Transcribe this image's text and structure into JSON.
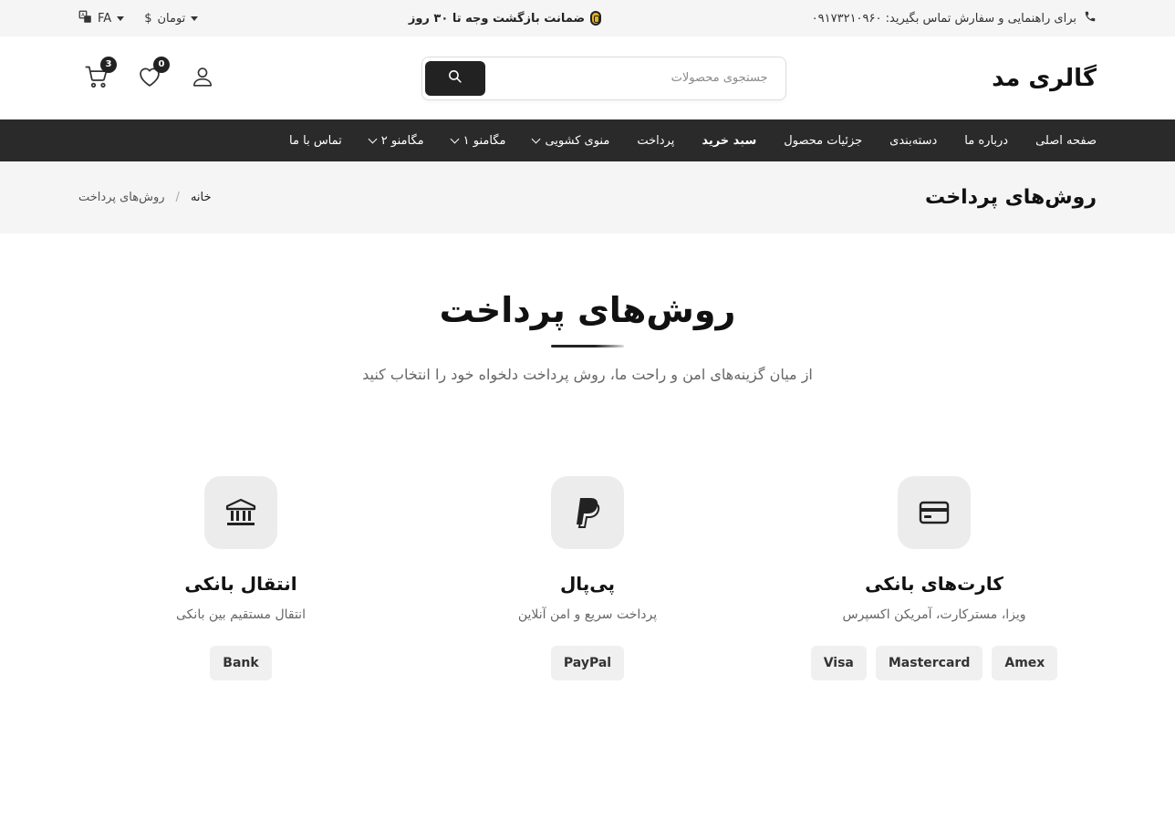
{
  "topbar": {
    "phone_text": "برای راهنمایی و سفارش تماس بگیرید: ۰۹۱۷۳۲۱۰۹۶۰",
    "promo": "ضمانت بازگشت وجه تا ۳۰ روز",
    "language": "FA",
    "currency_symbol": "$",
    "currency": "تومان"
  },
  "header": {
    "logo": "گالری مد",
    "search_placeholder": "جستجوی محصولات",
    "wishlist_count": "0",
    "cart_count": "3"
  },
  "nav": {
    "items": [
      {
        "label": "صفحه اصلی",
        "dropdown": false
      },
      {
        "label": "درباره ما",
        "dropdown": false
      },
      {
        "label": "دسته‌بندی",
        "dropdown": false
      },
      {
        "label": "جزئیات محصول",
        "dropdown": false
      },
      {
        "label": "سبد خرید",
        "dropdown": false,
        "active": true
      },
      {
        "label": "پرداخت",
        "dropdown": false
      },
      {
        "label": "منوی کشویی",
        "dropdown": true
      },
      {
        "label": "مگامنو ۱",
        "dropdown": true
      },
      {
        "label": "مگامنو ۲",
        "dropdown": true
      },
      {
        "label": "تماس با ما",
        "dropdown": false
      }
    ]
  },
  "titlebar": {
    "title": "روش‌های پرداخت",
    "crumb_home": "خانه",
    "crumb_sep": "/",
    "crumb_current": "روش‌های پرداخت"
  },
  "section": {
    "title": "روش‌های پرداخت",
    "subtitle": "از میان گزینه‌های امن و راحت ما، روش پرداخت دلخواه خود را انتخاب کنید"
  },
  "methods": [
    {
      "icon": "credit-card-icon",
      "title": "کارت‌های بانکی",
      "desc": "ویزا، مسترکارت، آمریکن اکسپرس",
      "tags": [
        "Visa",
        "Mastercard",
        "Amex"
      ]
    },
    {
      "icon": "paypal-icon",
      "title": "پی‌پال",
      "desc": "پرداخت سریع و امن آنلاین",
      "tags": [
        "PayPal"
      ]
    },
    {
      "icon": "bank-icon",
      "title": "انتقال بانکی",
      "desc": "انتقال مستقیم بین بانکی",
      "tags": [
        "Bank"
      ]
    }
  ]
}
